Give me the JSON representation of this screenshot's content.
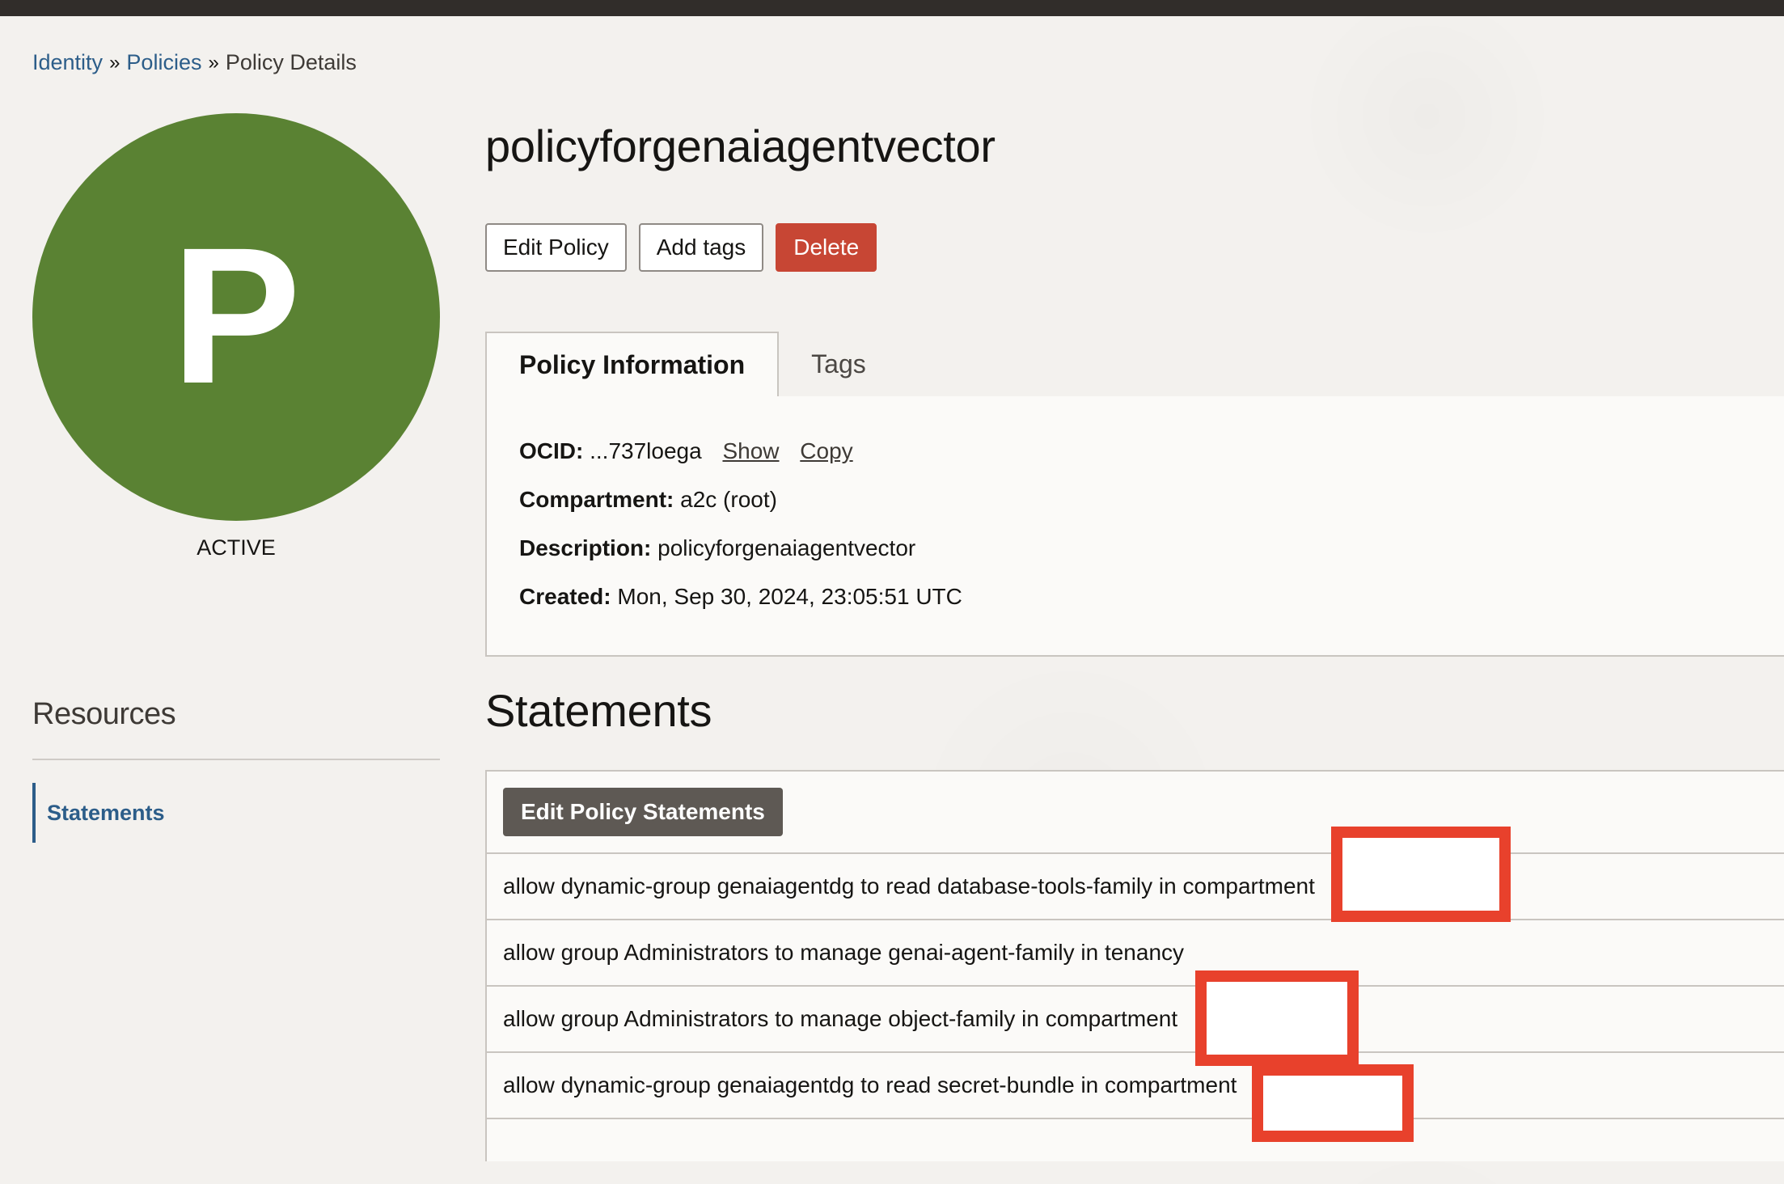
{
  "breadcrumb": {
    "items": [
      "Identity",
      "Policies"
    ],
    "separator": "»",
    "current": "Policy Details"
  },
  "resource": {
    "avatar_letter": "P",
    "avatar_color": "#5a8233",
    "status": "ACTIVE",
    "title": "policyforgenaiagentvector"
  },
  "actions": {
    "edit_label": "Edit Policy",
    "tags_label": "Add tags",
    "delete_label": "Delete"
  },
  "tabs": {
    "info_label": "Policy Information",
    "tags_label": "Tags"
  },
  "info": {
    "ocid_label": "OCID:",
    "ocid_value": "...737loega",
    "show_label": "Show",
    "copy_label": "Copy",
    "compartment_label": "Compartment:",
    "compartment_value": "a2c (root)",
    "description_label": "Description:",
    "description_value": "policyforgenaiagentvector",
    "created_label": "Created:",
    "created_value": "Mon, Sep 30, 2024, 23:05:51 UTC"
  },
  "sidebar": {
    "title": "Resources",
    "items": [
      {
        "label": "Statements",
        "active": true
      }
    ]
  },
  "statements": {
    "title": "Statements",
    "edit_label": "Edit Policy Statements",
    "rows": [
      "allow dynamic-group genaiagentdg to read database-tools-family in compartment",
      "allow group Administrators to manage genai-agent-family in tenancy",
      "allow group Administrators to manage object-family in compartment",
      "allow dynamic-group genaiagentdg to read secret-bundle in compartment"
    ]
  },
  "colors": {
    "accent_link": "#2c5d89",
    "danger": "#c74634",
    "redaction": "#e8412c",
    "topbar": "#312d2a"
  }
}
